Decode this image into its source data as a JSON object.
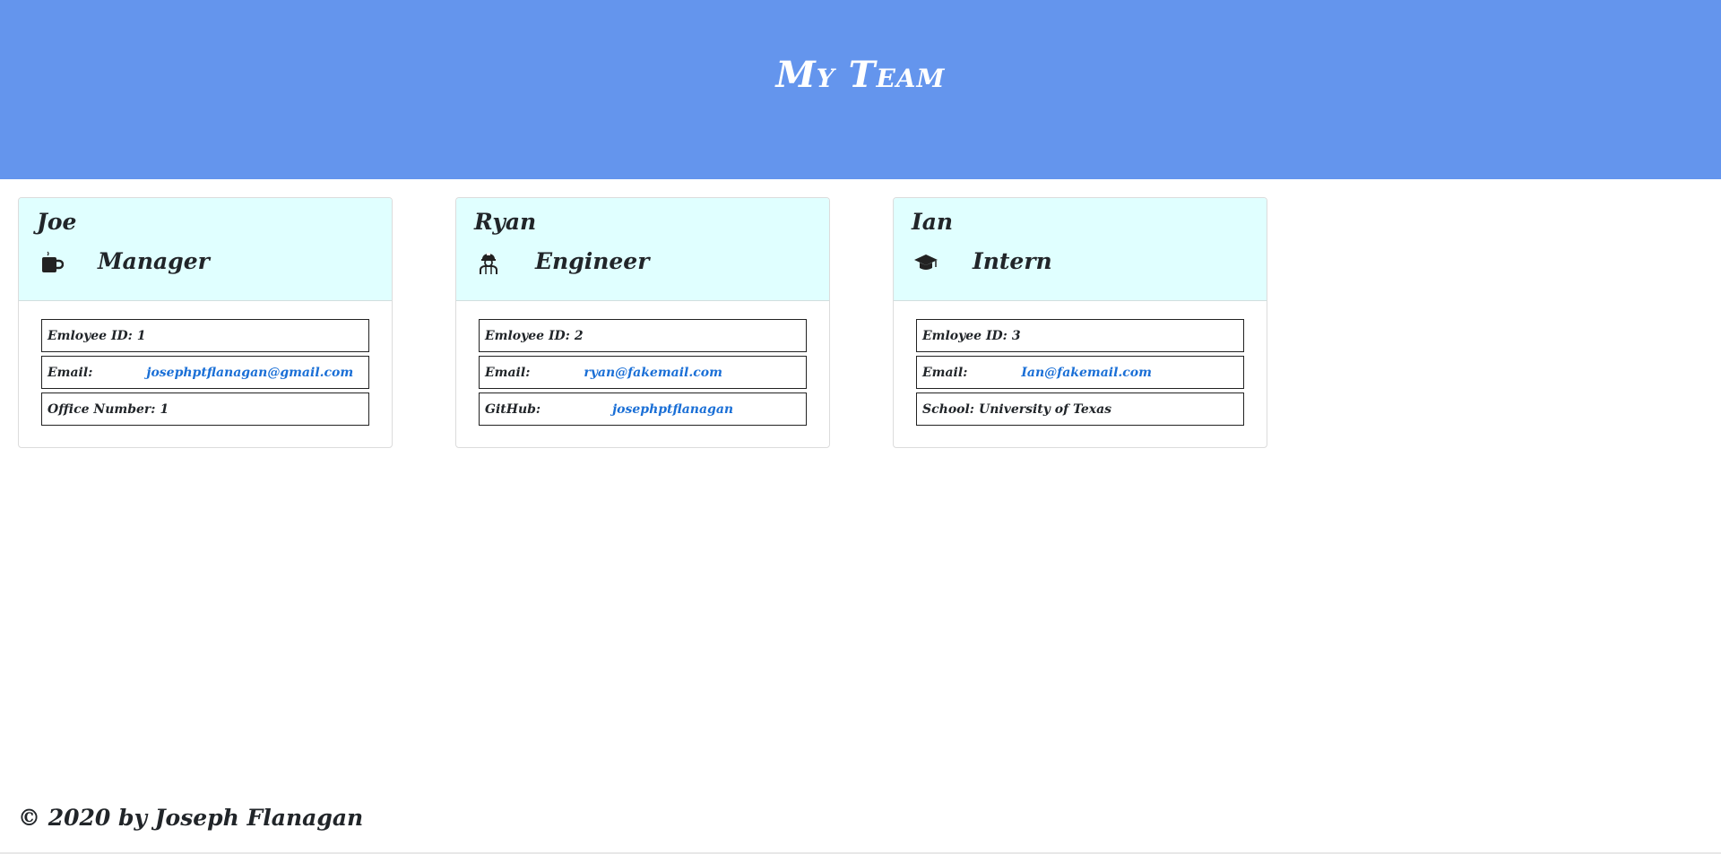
{
  "header": {
    "title": "My Team"
  },
  "cards": [
    {
      "name": "Joe",
      "role": "Manager",
      "icon": "mug-icon",
      "rows": [
        {
          "label": "Emloyee ID:",
          "value": "1"
        },
        {
          "label": "Email:",
          "value": "josephptflanagan@gmail.com"
        },
        {
          "label": "Office Number:",
          "value": "1"
        }
      ]
    },
    {
      "name": "Ryan",
      "role": "Engineer",
      "icon": "engineer-icon",
      "rows": [
        {
          "label": "Emloyee ID:",
          "value": "2"
        },
        {
          "label": "Email:",
          "value": "ryan@fakemail.com"
        },
        {
          "label": "GitHub:",
          "value": "josephptflanagan"
        }
      ]
    },
    {
      "name": "Ian",
      "role": "Intern",
      "icon": "graduation-cap-icon",
      "rows": [
        {
          "label": "Emloyee ID:",
          "value": "3"
        },
        {
          "label": "Email:",
          "value": "Ian@fakemail.com"
        },
        {
          "label": "School:",
          "value": "University of Texas"
        }
      ]
    }
  ],
  "footer": {
    "text": "© 2020 by Joseph Flanagan"
  },
  "colors": {
    "header_bg": "#6495ed",
    "card_header_bg": "#e0ffff",
    "link": "#1a6fd6"
  }
}
